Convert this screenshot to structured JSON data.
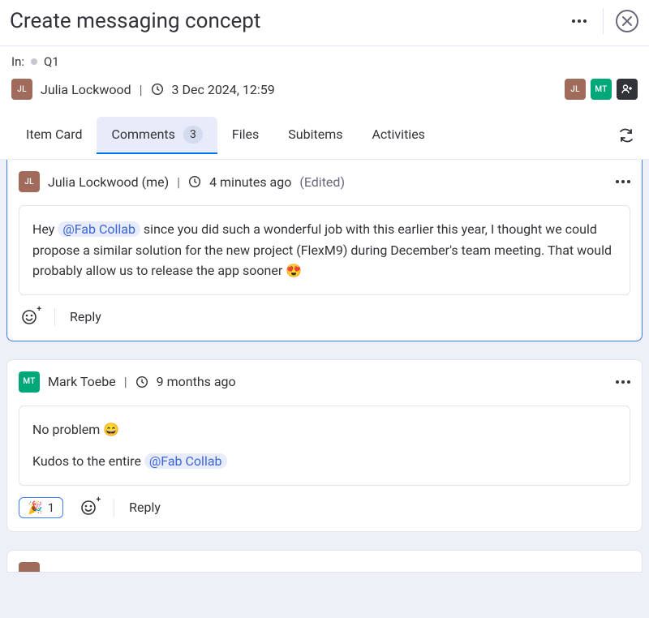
{
  "header": {
    "title": "Create messaging concept"
  },
  "meta": {
    "in_label": "In:",
    "parent": "Q1"
  },
  "creator": {
    "initials": "JL",
    "name": "Julia Lockwood",
    "timestamp": "3 Dec 2024, 12:59"
  },
  "participants": [
    {
      "initials": "JL",
      "style": "jl"
    },
    {
      "initials": "MT",
      "style": "mt"
    }
  ],
  "tabs": {
    "item_card": "Item Card",
    "comments": "Comments",
    "comments_count": "3",
    "files": "Files",
    "subitems": "Subitems",
    "activities": "Activities"
  },
  "comments": [
    {
      "author_initials": "JL",
      "author_style": "jl",
      "author": "Julia Lockwood (me)",
      "time": "4 minutes ago",
      "edited_label": "(Edited)",
      "body_prefix": "Hey ",
      "mention": "@Fab Collab",
      "body_suffix": " since you did such a wonderful job with this earlier this year, I thought we could propose a similar solution for the new project (FlexM9) during December's team meeting. That would probably allow us to release the app sooner 😍",
      "reply_label": "Reply"
    },
    {
      "author_initials": "MT",
      "author_style": "mt",
      "author": "Mark Toebe",
      "time": "9 months ago",
      "line1": "No problem 😄",
      "line2_prefix": "Kudos to the entire ",
      "line2_mention": "@Fab Collab",
      "reaction_emoji": "🎉",
      "reaction_count": "1",
      "reply_label": "Reply"
    }
  ]
}
